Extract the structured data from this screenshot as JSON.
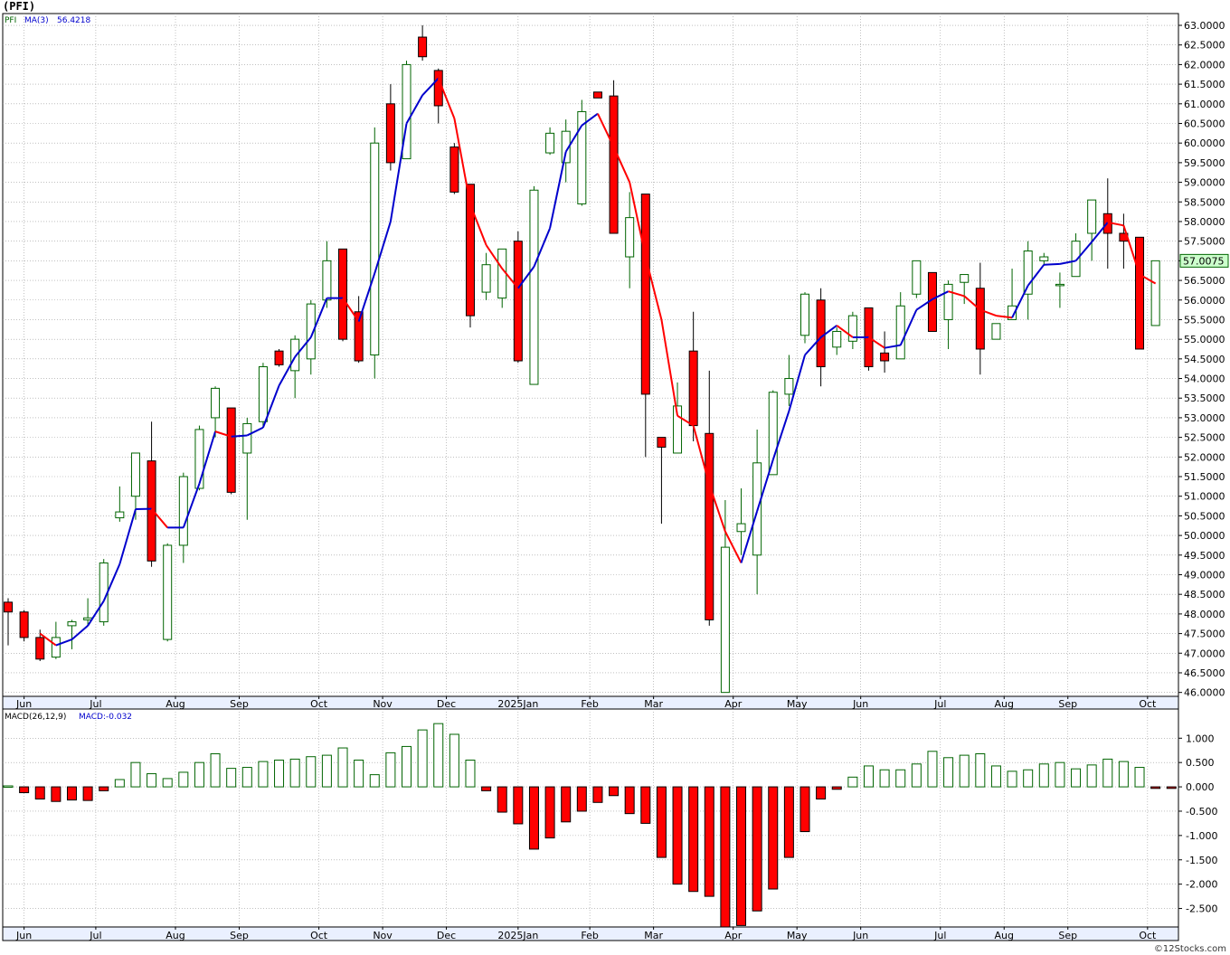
{
  "title": "(PFI)",
  "credit": "©12Stocks.com",
  "colors": {
    "up_stroke": "#006400",
    "down_fill": "#ff0000",
    "ma_up": "#0000cc",
    "ma_down": "#ff0000",
    "grid": "#9a9a9a",
    "price_tag_bg": "#ccffcc"
  },
  "chart_data": [
    {
      "type": "candlestick",
      "legend": {
        "ticker": "PFI",
        "ma_label": "MA(3)",
        "ma_value": "56.4218"
      },
      "last_price_label": "57.0075",
      "ylim": [
        45.9,
        63.3
      ],
      "y_ticks": [
        "46.0000",
        "46.5000",
        "47.0000",
        "47.5000",
        "48.0000",
        "48.5000",
        "49.0000",
        "49.5000",
        "50.0000",
        "50.5000",
        "51.0000",
        "51.5000",
        "52.0000",
        "52.5000",
        "53.0000",
        "53.5000",
        "54.0000",
        "54.5000",
        "55.0000",
        "55.5000",
        "56.0000",
        "56.5000",
        "57.0000",
        "57.5000",
        "58.0000",
        "58.5000",
        "59.0000",
        "59.5000",
        "60.0000",
        "60.5000",
        "61.0000",
        "61.5000",
        "62.0000",
        "62.5000",
        "63.0000"
      ],
      "month_labels": [
        {
          "label": "Jun",
          "week": 1
        },
        {
          "label": "Jul",
          "week": 5.5
        },
        {
          "label": "Aug",
          "week": 10.5
        },
        {
          "label": "Sep",
          "week": 14.5
        },
        {
          "label": "Oct",
          "week": 19.5
        },
        {
          "label": "Nov",
          "week": 23.5
        },
        {
          "label": "Dec",
          "week": 27.5
        },
        {
          "label": "2025Jan",
          "week": 32
        },
        {
          "label": "Feb",
          "week": 36.5
        },
        {
          "label": "Mar",
          "week": 40.5
        },
        {
          "label": "Apr",
          "week": 45.5
        },
        {
          "label": "May",
          "week": 49.5
        },
        {
          "label": "Jun",
          "week": 53.5
        },
        {
          "label": "Jul",
          "week": 58.5
        },
        {
          "label": "Aug",
          "week": 62.5
        },
        {
          "label": "Sep",
          "week": 66.5
        },
        {
          "label": "Oct",
          "week": 71.5
        }
      ],
      "candles": [
        {
          "o": 48.3,
          "h": 48.4,
          "l": 47.2,
          "c": 48.05
        },
        {
          "o": 48.05,
          "h": 48.1,
          "l": 47.3,
          "c": 47.4
        },
        {
          "o": 47.4,
          "h": 47.6,
          "l": 46.8,
          "c": 46.85
        },
        {
          "o": 46.9,
          "h": 47.8,
          "l": 46.85,
          "c": 47.4
        },
        {
          "o": 47.7,
          "h": 47.85,
          "l": 47.1,
          "c": 47.8
        },
        {
          "o": 47.85,
          "h": 48.4,
          "l": 47.7,
          "c": 47.9
        },
        {
          "o": 47.8,
          "h": 49.4,
          "l": 47.7,
          "c": 49.3
        },
        {
          "o": 50.45,
          "h": 51.25,
          "l": 50.35,
          "c": 50.6
        },
        {
          "o": 51.0,
          "h": 52.1,
          "l": 50.4,
          "c": 52.1
        },
        {
          "o": 51.9,
          "h": 52.9,
          "l": 49.2,
          "c": 49.35
        },
        {
          "o": 47.35,
          "h": 49.8,
          "l": 47.3,
          "c": 49.75
        },
        {
          "o": 49.75,
          "h": 51.6,
          "l": 49.3,
          "c": 51.5
        },
        {
          "o": 51.2,
          "h": 52.8,
          "l": 51.15,
          "c": 52.7
        },
        {
          "o": 53.0,
          "h": 53.8,
          "l": 52.5,
          "c": 53.75
        },
        {
          "o": 53.25,
          "h": 53.25,
          "l": 51.05,
          "c": 51.1
        },
        {
          "o": 52.1,
          "h": 53.0,
          "l": 50.4,
          "c": 52.85
        },
        {
          "o": 52.9,
          "h": 54.4,
          "l": 52.75,
          "c": 54.3
        },
        {
          "o": 54.7,
          "h": 54.75,
          "l": 54.3,
          "c": 54.35
        },
        {
          "o": 54.2,
          "h": 55.1,
          "l": 53.5,
          "c": 55.0
        },
        {
          "o": 54.5,
          "h": 56.0,
          "l": 54.1,
          "c": 55.9
        },
        {
          "o": 56.0,
          "h": 57.5,
          "l": 55.8,
          "c": 57.0
        },
        {
          "o": 57.3,
          "h": 57.3,
          "l": 54.95,
          "c": 55.0
        },
        {
          "o": 55.7,
          "h": 56.1,
          "l": 54.4,
          "c": 54.45
        },
        {
          "o": 54.6,
          "h": 60.4,
          "l": 54.0,
          "c": 60.0
        },
        {
          "o": 61.0,
          "h": 61.5,
          "l": 59.3,
          "c": 59.5
        },
        {
          "o": 59.6,
          "h": 62.1,
          "l": 59.6,
          "c": 62.0
        },
        {
          "o": 62.7,
          "h": 63.0,
          "l": 62.1,
          "c": 62.2
        },
        {
          "o": 61.85,
          "h": 61.9,
          "l": 60.5,
          "c": 60.95
        },
        {
          "o": 59.9,
          "h": 60.0,
          "l": 58.7,
          "c": 58.75
        },
        {
          "o": 58.95,
          "h": 58.95,
          "l": 55.3,
          "c": 55.6
        },
        {
          "o": 56.2,
          "h": 57.2,
          "l": 56.0,
          "c": 56.9
        },
        {
          "o": 56.05,
          "h": 57.3,
          "l": 55.8,
          "c": 57.3
        },
        {
          "o": 57.5,
          "h": 57.75,
          "l": 54.4,
          "c": 54.45
        },
        {
          "o": 53.85,
          "h": 58.9,
          "l": 53.85,
          "c": 58.8
        },
        {
          "o": 59.75,
          "h": 60.4,
          "l": 59.7,
          "c": 60.25
        },
        {
          "o": 59.5,
          "h": 60.6,
          "l": 59.0,
          "c": 60.3
        },
        {
          "o": 58.45,
          "h": 61.1,
          "l": 58.4,
          "c": 60.8
        },
        {
          "o": 61.3,
          "h": 61.3,
          "l": 61.15,
          "c": 61.15
        },
        {
          "o": 61.2,
          "h": 61.6,
          "l": 57.7,
          "c": 57.7
        },
        {
          "o": 57.1,
          "h": 58.75,
          "l": 56.3,
          "c": 58.1
        },
        {
          "o": 58.7,
          "h": 58.7,
          "l": 52.0,
          "c": 53.6
        },
        {
          "o": 52.5,
          "h": 52.5,
          "l": 50.3,
          "c": 52.25
        },
        {
          "o": 52.1,
          "h": 53.9,
          "l": 52.1,
          "c": 53.3
        },
        {
          "o": 54.7,
          "h": 55.7,
          "l": 52.4,
          "c": 52.8
        },
        {
          "o": 52.6,
          "h": 54.2,
          "l": 47.7,
          "c": 47.85
        },
        {
          "o": 46.0,
          "h": 50.9,
          "l": 46.0,
          "c": 49.7
        },
        {
          "o": 50.1,
          "h": 51.2,
          "l": 49.5,
          "c": 50.3
        },
        {
          "o": 49.5,
          "h": 52.7,
          "l": 48.5,
          "c": 51.85
        },
        {
          "o": 51.55,
          "h": 53.7,
          "l": 51.55,
          "c": 53.65
        },
        {
          "o": 53.6,
          "h": 54.6,
          "l": 53.3,
          "c": 54.0
        },
        {
          "o": 55.1,
          "h": 56.2,
          "l": 54.9,
          "c": 56.15
        },
        {
          "o": 56.0,
          "h": 56.3,
          "l": 53.8,
          "c": 54.3
        },
        {
          "o": 54.8,
          "h": 55.3,
          "l": 54.6,
          "c": 55.2
        },
        {
          "o": 54.95,
          "h": 55.7,
          "l": 54.75,
          "c": 55.6
        },
        {
          "o": 55.8,
          "h": 55.8,
          "l": 54.2,
          "c": 54.3
        },
        {
          "o": 54.65,
          "h": 55.2,
          "l": 54.15,
          "c": 54.45
        },
        {
          "o": 54.5,
          "h": 56.2,
          "l": 54.5,
          "c": 55.85
        },
        {
          "o": 56.15,
          "h": 57.0,
          "l": 56.05,
          "c": 57.0
        },
        {
          "o": 56.7,
          "h": 56.7,
          "l": 55.2,
          "c": 55.2
        },
        {
          "o": 55.5,
          "h": 56.5,
          "l": 54.75,
          "c": 56.4
        },
        {
          "o": 56.45,
          "h": 56.65,
          "l": 55.9,
          "c": 56.65
        },
        {
          "o": 56.3,
          "h": 56.95,
          "l": 54.1,
          "c": 54.75
        },
        {
          "o": 55.0,
          "h": 55.4,
          "l": 55.0,
          "c": 55.4
        },
        {
          "o": 55.5,
          "h": 56.8,
          "l": 55.5,
          "c": 55.85
        },
        {
          "o": 56.15,
          "h": 57.5,
          "l": 55.5,
          "c": 57.25
        },
        {
          "o": 57.0,
          "h": 57.2,
          "l": 56.9,
          "c": 57.1
        },
        {
          "o": 56.4,
          "h": 56.7,
          "l": 55.8,
          "c": 56.4
        },
        {
          "o": 56.6,
          "h": 57.7,
          "l": 56.6,
          "c": 57.5
        },
        {
          "o": 57.7,
          "h": 58.55,
          "l": 57.0,
          "c": 58.55
        },
        {
          "o": 58.2,
          "h": 59.1,
          "l": 56.8,
          "c": 57.7
        },
        {
          "o": 57.7,
          "h": 58.2,
          "l": 56.8,
          "c": 57.5
        },
        {
          "o": 57.6,
          "h": 57.6,
          "l": 54.75,
          "c": 54.75
        },
        {
          "o": 55.35,
          "h": 57.0,
          "l": 55.35,
          "c": 57.0
        }
      ],
      "ma3": [
        null,
        null,
        47.5,
        47.2,
        47.35,
        47.7,
        48.33,
        49.27,
        50.67,
        50.68,
        50.2,
        50.2,
        51.32,
        52.65,
        52.52,
        52.55,
        52.75,
        53.82,
        54.55,
        55.05,
        56.05,
        56.05,
        55.45,
        56.68,
        58.0,
        60.5,
        61.22,
        61.65,
        60.63,
        58.43,
        57.4,
        56.8,
        56.3,
        56.85,
        57.83,
        59.78,
        60.45,
        60.75,
        59.9,
        59.0,
        57.1,
        55.5,
        53.05,
        52.8,
        51.3,
        50.1,
        49.3,
        50.62,
        51.93,
        53.17,
        54.6,
        55.05,
        55.35,
        55.05,
        55.05,
        54.78,
        54.85,
        55.75,
        56.02,
        56.22,
        56.1,
        55.75,
        55.6,
        55.55,
        56.37,
        56.9,
        56.92,
        57.0,
        57.48,
        57.98,
        57.9,
        56.65,
        56.42
      ]
    },
    {
      "type": "bar",
      "legend": {
        "name": "MACD(26,12,9)",
        "value_label": "MACD:-0.032"
      },
      "ylim": [
        -2.88,
        1.6
      ],
      "y_ticks": [
        "1.000",
        "0.500",
        "0.000",
        "-0.500",
        "-1.000",
        "-1.500",
        "-2.000",
        "-2.500"
      ],
      "values": [
        0.02,
        -0.12,
        -0.25,
        -0.3,
        -0.27,
        -0.28,
        -0.08,
        0.15,
        0.5,
        0.27,
        0.17,
        0.3,
        0.5,
        0.68,
        0.38,
        0.4,
        0.52,
        0.55,
        0.57,
        0.62,
        0.65,
        0.8,
        0.55,
        0.25,
        0.7,
        0.83,
        1.17,
        1.3,
        1.08,
        0.55,
        -0.08,
        -0.52,
        -0.76,
        -1.28,
        -1.05,
        -0.72,
        -0.5,
        -0.32,
        -0.18,
        -0.55,
        -0.75,
        -1.45,
        -2.0,
        -2.15,
        -2.25,
        -2.88,
        -2.85,
        -2.55,
        -2.1,
        -1.45,
        -0.92,
        -0.25,
        -0.05,
        0.2,
        0.43,
        0.35,
        0.35,
        0.47,
        0.73,
        0.6,
        0.65,
        0.68,
        0.43,
        0.32,
        0.35,
        0.47,
        0.5,
        0.37,
        0.45,
        0.57,
        0.52,
        0.4,
        -0.032,
        -0.032
      ]
    }
  ]
}
